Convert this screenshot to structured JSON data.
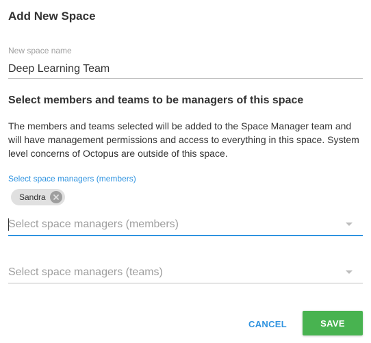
{
  "dialog": {
    "title": "Add New Space",
    "name_field": {
      "label": "New space name",
      "value": "Deep Learning Team"
    },
    "section_heading": "Select members and teams to be managers of this space",
    "description": "The members and teams selected will be added to the Space Manager team and will have management permissions and access to everything in this space. System level concerns of Octopus are outside of this space.",
    "members": {
      "label": "Select space managers (members)",
      "chips": [
        "Sandra"
      ],
      "placeholder": "Select space managers (members)"
    },
    "teams": {
      "placeholder": "Select space managers (teams)"
    },
    "buttons": {
      "cancel": "CANCEL",
      "save": "SAVE"
    }
  },
  "colors": {
    "accent": "#2f93e0",
    "save_button": "#48b350",
    "chip_bg": "#e0e0e0"
  },
  "icons": {
    "chip_remove": "close-circle-icon",
    "dropdown": "caret-down-icon"
  }
}
